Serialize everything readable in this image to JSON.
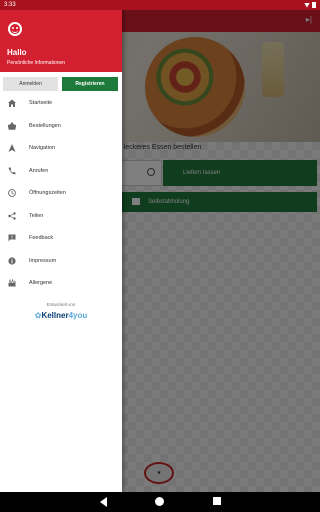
{
  "status_bar": {
    "time": "3:33"
  },
  "drawer": {
    "greeting": "Hallo",
    "subtitle": "Persönliche Informationen",
    "login_label": "Anmelden",
    "register_label": "Registrieren",
    "menu": [
      {
        "label": "Startseite",
        "icon": "home-icon"
      },
      {
        "label": "Bestellungen",
        "icon": "basket-icon"
      },
      {
        "label": "Navigation",
        "icon": "navigation-arrow-icon"
      },
      {
        "label": "Anrufen",
        "icon": "phone-icon"
      },
      {
        "label": "Öffnungszeiten",
        "icon": "clock-icon"
      },
      {
        "label": "Teilen",
        "icon": "share-icon"
      },
      {
        "label": "Feedback",
        "icon": "feedback-icon"
      },
      {
        "label": "Impressum",
        "icon": "info-icon"
      },
      {
        "label": "Allergene",
        "icon": "allergens-icon"
      }
    ],
    "credit": "Entwickelt von",
    "brand_main": "Kellner",
    "brand_accent": "4you"
  },
  "app": {
    "order_prompt": "h leckeres Essen bestellen",
    "deliver_label": "Liefern lassen",
    "pickup_label": "Selbstabholung"
  },
  "colors": {
    "primary_red": "#d32030",
    "green": "#1e7a3a"
  }
}
